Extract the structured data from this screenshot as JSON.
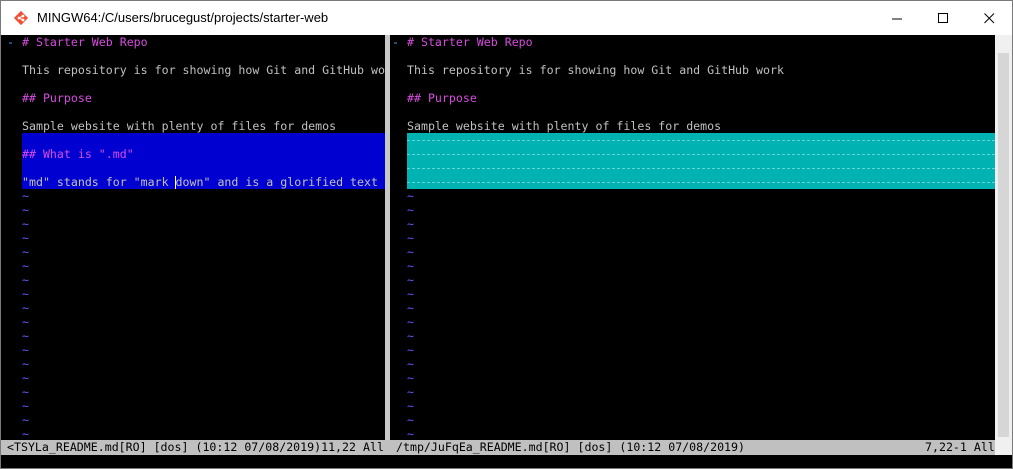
{
  "window": {
    "title": "MINGW64:/C/users/brucegust/projects/starter-web",
    "controls": {
      "minimize": "minimize",
      "maximize": "maximize",
      "close": "close"
    }
  },
  "left_pane": {
    "lines": [
      {
        "fold": "-",
        "text": "# Starter Web Repo",
        "style": "heading"
      },
      {
        "fold": "",
        "text": "",
        "style": "normal"
      },
      {
        "fold": "",
        "text": "This repository is for showing how Git and GitHub wo",
        "style": "normal"
      },
      {
        "fold": "",
        "text": "",
        "style": "normal"
      },
      {
        "fold": "",
        "text": "## Purpose",
        "style": "heading"
      },
      {
        "fold": "",
        "text": "",
        "style": "normal"
      },
      {
        "fold": "",
        "text": "Sample website with plenty of files for demos",
        "style": "normal"
      },
      {
        "fold": "",
        "text": "",
        "style": "normal"
      },
      {
        "fold": "",
        "text": "## What is \".md\"",
        "style": "heading"
      },
      {
        "fold": "",
        "text": "",
        "style": "normal"
      },
      {
        "fold": "",
        "text": "\"md\" stands for \"mark down\" and is a glorified text",
        "style": "normal"
      }
    ],
    "tilde": "~"
  },
  "right_pane": {
    "lines": [
      {
        "fold": "-",
        "text": "# Starter Web Repo",
        "style": "heading"
      },
      {
        "fold": "",
        "text": "",
        "style": "normal"
      },
      {
        "fold": "",
        "text": "This repository is for showing how Git and GitHub work",
        "style": "normal"
      },
      {
        "fold": "",
        "text": "",
        "style": "normal"
      },
      {
        "fold": "",
        "text": "## Purpose",
        "style": "heading"
      },
      {
        "fold": "",
        "text": "",
        "style": "normal"
      },
      {
        "fold": "",
        "text": "Sample website with plenty of files for demos",
        "style": "normal"
      }
    ],
    "tilde": "~"
  },
  "status": {
    "left": "<TSYLa_README.md[RO] [dos] (10:12 07/08/2019)11,22 All",
    "right": "/tmp/JuFqEa_README.md[RO] [dos] (10:12 07/08/2019)",
    "right_pos": "7,22-1 All"
  },
  "colors": {
    "heading": "#d84be0",
    "tilde": "#5c5cff",
    "diff_change": "#0000d0",
    "diff_filler": "#00b2b2",
    "background": "#000000"
  }
}
